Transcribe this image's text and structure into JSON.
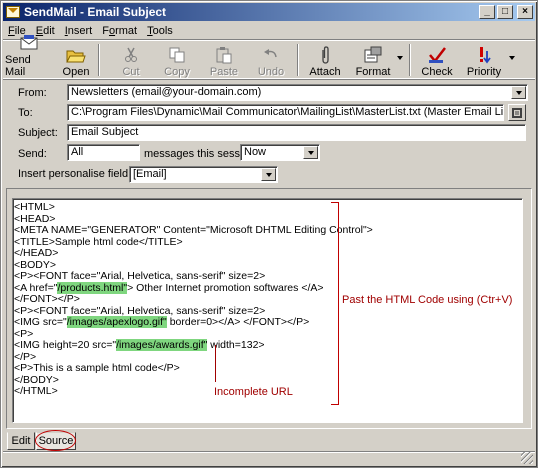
{
  "window": {
    "title": "SendMail - Email Subject",
    "minimize_glyph": "_",
    "maximize_glyph": "□",
    "close_glyph": "×"
  },
  "menu": [
    {
      "label": "File",
      "accel": "F",
      "rest": "ile"
    },
    {
      "label": "Edit",
      "accel": "E",
      "rest": "dit"
    },
    {
      "label": "Insert",
      "accel": "I",
      "rest": "nsert"
    },
    {
      "label": "Format",
      "accel": "o",
      "pre": "F",
      "rest": "rmat"
    },
    {
      "label": "Tools",
      "accel": "T",
      "rest": "ools"
    }
  ],
  "toolbar": {
    "send_mail": "Send Mail",
    "open": "Open",
    "cut": "Cut",
    "copy": "Copy",
    "paste": "Paste",
    "undo": "Undo",
    "attach": "Attach",
    "format": "Format",
    "check": "Check",
    "priority": "Priority"
  },
  "form": {
    "from_label": "From:",
    "from_value": "Newsletters (email@your-domain.com)",
    "to_label": "To:",
    "to_value": "C:\\Program Files\\Dynamic\\Mail Communicator\\MailingList\\MasterList.txt (Master Email List)",
    "subject_label": "Subject:",
    "subject_value": "Email Subject",
    "send_label": "Send:",
    "send_value": "All",
    "messages_label": "messages this session",
    "when_value": "Now",
    "personalise_label": "Insert personalise field:",
    "personalise_value": "[Email]"
  },
  "code": {
    "l1": "<HTML>",
    "l2": "<HEAD>",
    "l3": "<META NAME=\"GENERATOR\" Content=\"Microsoft DHTML Editing Control\">",
    "l4": "<TITLE>Sample html code</TITLE>",
    "l5": "</HEAD>",
    "l6": "<BODY>",
    "l7": "<P><FONT face=\"Arial, Helvetica, sans-serif\" size=2>",
    "l8a": "<A href=\"",
    "l8b": "/products.html\"",
    "l8c": "> Other Internet promotion softwares </A>",
    "l9": "</FONT></P>",
    "l10": "<P><FONT face=\"Arial, Helvetica, sans-serif\" size=2>",
    "l11a": "<IMG src=\"",
    "l11b": "/images/apexlogo.gif\"",
    "l11c": " border=0></A> </FONT></P>",
    "l12": "<P>",
    "l13a": "<IMG height=20 src=\"",
    "l13b": "/images/awards.gif\"",
    "l13c": " width=132>",
    "l14": "</P>",
    "l15": "<P>This is a sample html code</P>",
    "l16": "</BODY>",
    "l17": "</HTML>"
  },
  "annotations": {
    "paste_note": "Past the HTML Code using (Ctr+V)",
    "incomplete_note": "Incomplete URL"
  },
  "tabs": {
    "edit": "Edit",
    "source": "Source"
  },
  "colors": {
    "highlight": "#7fd67f",
    "annotation": "#a00000",
    "titlebar_start": "#0a246a",
    "titlebar_end": "#a6caf0"
  }
}
